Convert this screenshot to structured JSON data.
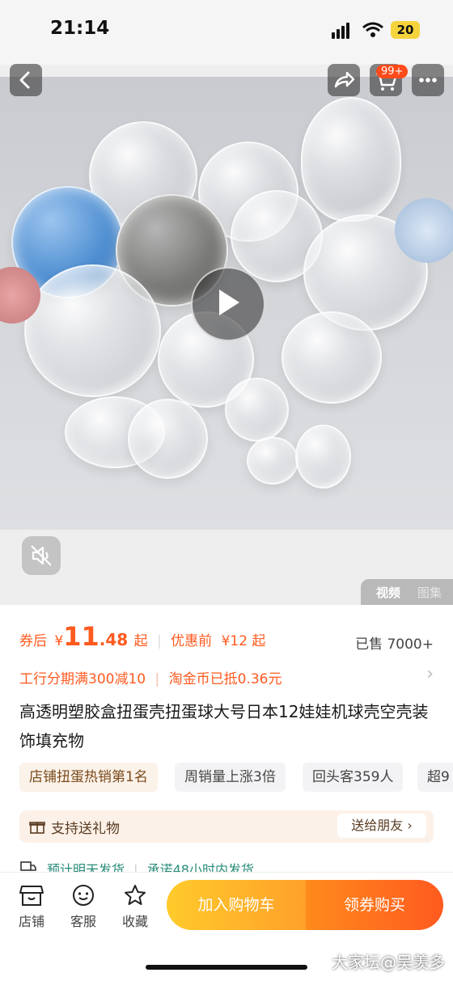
{
  "status_bar": {
    "time": "21:14",
    "battery": "20"
  },
  "header": {
    "cart_badge": "99+",
    "icons": [
      "back-icon",
      "share-icon",
      "cart-icon",
      "more-icon"
    ]
  },
  "media": {
    "tab_video": "视频",
    "tab_gallery": "图集",
    "icons": [
      "play-icon",
      "mute-icon"
    ]
  },
  "price": {
    "after_coupon_label": "券后",
    "currency": "¥",
    "integer": "11",
    "decimal": ".48",
    "suffix": "起",
    "before_label": "优惠前",
    "before_price": "¥12",
    "before_suffix": "起",
    "sold": "已售 7000+"
  },
  "promo": {
    "installment": "工行分期满300减10",
    "coins": "淘金币已抵0.36元"
  },
  "title": "高透明塑胶盒扭蛋壳扭蛋球大号日本12娃娃机球壳空壳装饰填充物",
  "tags": [
    "店铺扭蛋热销第1名",
    "周销量上涨3倍",
    "回头客359人",
    "超9"
  ],
  "gift": {
    "label": "支持送礼物",
    "button": "送给朋友"
  },
  "shipping": {
    "estimate": "预计明天发货",
    "promise": "承诺48小时内发货"
  },
  "bottom_nav": [
    {
      "label": "店铺",
      "icon": "shop-icon"
    },
    {
      "label": "客服",
      "icon": "service-icon"
    },
    {
      "label": "收藏",
      "icon": "star-icon"
    }
  ],
  "actions": {
    "add_to_cart": "加入购物车",
    "buy": "领券购买"
  },
  "watermark": "大家坛@吴羡多",
  "colors": {
    "accent": "#ff5a1f",
    "cart_yellow": "#ffb62a",
    "ship_green": "#2a8c7a"
  }
}
